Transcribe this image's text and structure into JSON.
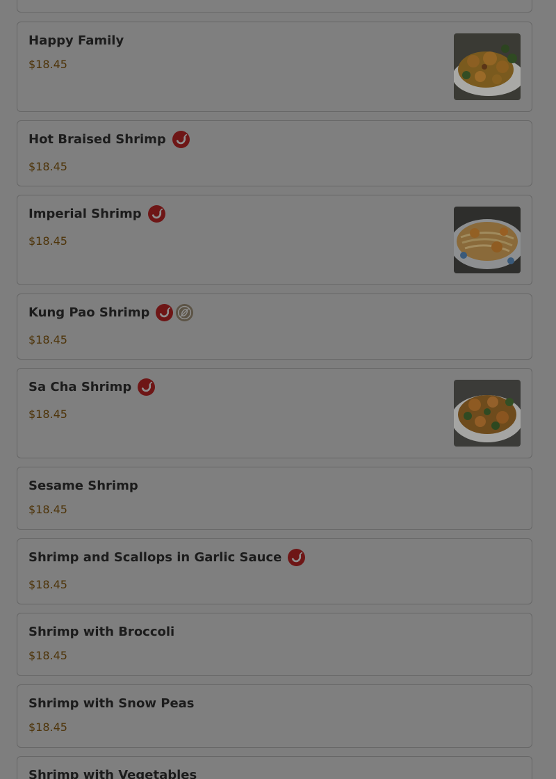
{
  "colors": {
    "overlay_background": "#7e7e7e",
    "card_background": "#7f7f7f",
    "card_border": "#666666",
    "title_text": "#1c1c1c",
    "price_text": "#4e3409",
    "spicy_badge": "#6e1616",
    "peanut_badge": "#5c5446"
  },
  "badge_icons": {
    "spicy": "chili-pepper-icon",
    "peanut": "peanut-allergen-icon"
  },
  "menu": {
    "items": [
      {
        "name": "",
        "price": "",
        "badges": [],
        "has_image": false,
        "image_icon": ""
      },
      {
        "name": "Happy Family",
        "price": "$18.45",
        "badges": [],
        "has_image": true,
        "image_icon": "dish-photo-icon"
      },
      {
        "name": "Hot Braised Shrimp",
        "price": "$18.45",
        "badges": [
          "spicy"
        ],
        "has_image": false,
        "image_icon": ""
      },
      {
        "name": "Imperial Shrimp",
        "price": "$18.45",
        "badges": [
          "spicy"
        ],
        "has_image": true,
        "image_icon": "dish-photo-icon"
      },
      {
        "name": "Kung Pao Shrimp",
        "price": "$18.45",
        "badges": [
          "spicy",
          "peanut"
        ],
        "has_image": false,
        "image_icon": ""
      },
      {
        "name": "Sa Cha Shrimp",
        "price": "$18.45",
        "badges": [
          "spicy"
        ],
        "has_image": true,
        "image_icon": "dish-photo-icon"
      },
      {
        "name": "Sesame Shrimp",
        "price": "$18.45",
        "badges": [],
        "has_image": false,
        "image_icon": ""
      },
      {
        "name": "Shrimp and Scallops in Garlic Sauce",
        "price": "$18.45",
        "badges": [
          "spicy"
        ],
        "has_image": false,
        "image_icon": ""
      },
      {
        "name": "Shrimp with Broccoli",
        "price": "$18.45",
        "badges": [],
        "has_image": false,
        "image_icon": ""
      },
      {
        "name": "Shrimp with Snow Peas",
        "price": "$18.45",
        "badges": [],
        "has_image": false,
        "image_icon": ""
      },
      {
        "name": "Shrimp with Vegetables",
        "price": "",
        "badges": [],
        "has_image": false,
        "image_icon": ""
      }
    ]
  }
}
